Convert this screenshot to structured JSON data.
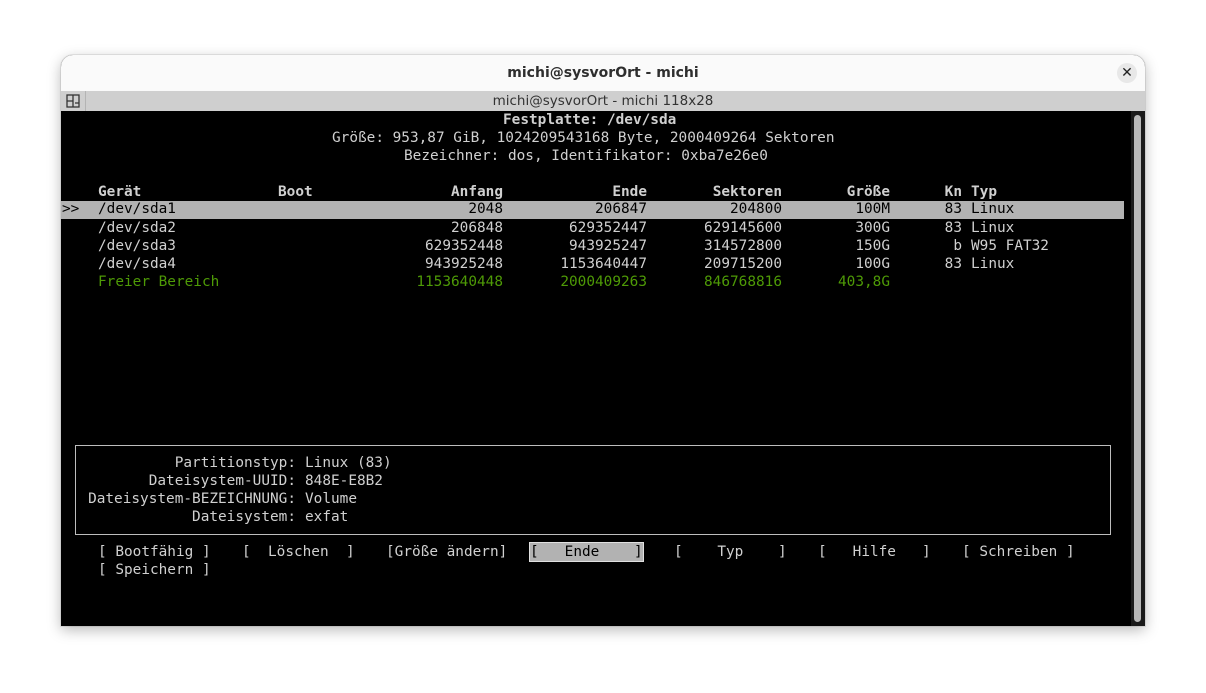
{
  "window": {
    "title": "michi@sysvorOrt - michi",
    "tab_title": "michi@sysvorOrt - michi 118x28",
    "close_glyph": "✕"
  },
  "disk": {
    "title": "Festplatte: /dev/sda",
    "size_line": "Größe: 953,87 GiB, 1024209543168 Byte, 2000409264 Sektoren",
    "id_line": "Bezeichner: dos, Identifikator: 0xba7e26e0"
  },
  "table": {
    "headers": {
      "device": "Gerät",
      "boot": "Boot",
      "start": "Anfang",
      "end": "Ende",
      "sectors": "Sektoren",
      "size": "Größe",
      "id": "Kn",
      "type": "Typ"
    },
    "cursor": ">>",
    "rows": [
      {
        "device": "/dev/sda1",
        "boot": "",
        "start": "2048",
        "end": "206847",
        "sectors": "204800",
        "size": "100M",
        "id": "83",
        "type": "Linux"
      },
      {
        "device": "/dev/sda2",
        "boot": "",
        "start": "206848",
        "end": "629352447",
        "sectors": "629145600",
        "size": "300G",
        "id": "83",
        "type": "Linux"
      },
      {
        "device": "/dev/sda3",
        "boot": "",
        "start": "629352448",
        "end": "943925247",
        "sectors": "314572800",
        "size": "150G",
        "id": "b",
        "type": "W95 FAT32"
      },
      {
        "device": "/dev/sda4",
        "boot": "",
        "start": "943925248",
        "end": "1153640447",
        "sectors": "209715200",
        "size": "100G",
        "id": "83",
        "type": "Linux"
      }
    ],
    "free": {
      "device": "Freier Bereich",
      "start": "1153640448",
      "end": "2000409263",
      "sectors": "846768816",
      "size": "403,8G"
    }
  },
  "info": {
    "type_label": "Partitionstyp:",
    "type_value": "Linux (83)",
    "uuid_label": "Dateisystem-UUID:",
    "uuid_value": "848E-E8B2",
    "fslabel_label": "Dateisystem-BEZEICHNUNG:",
    "fslabel_value": "Volume",
    "fs_label": "Dateisystem:",
    "fs_value": "exfat"
  },
  "menu": {
    "bootable": "[ Bootfähig ]",
    "delete": "[  Löschen  ]",
    "resize": "[Größe ändern]",
    "quit": "[   Ende    ]",
    "type": "[    Typ    ]",
    "help": "[   Hilfe   ]",
    "write": "[ Schreiben ]",
    "dump": "[ Speichern ]"
  },
  "colors": {
    "selection": "#b2b2b2",
    "free_space": "#4e9a06",
    "terminal_bg": "#000000"
  }
}
